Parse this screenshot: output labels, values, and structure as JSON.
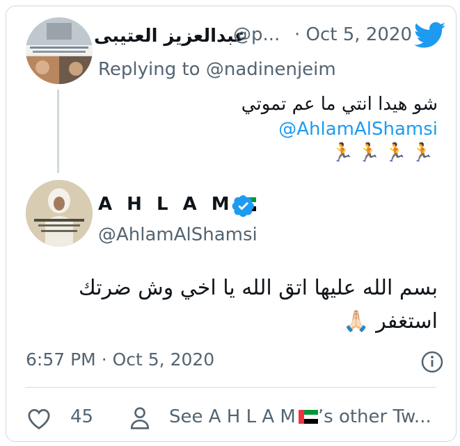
{
  "reply_tweet": {
    "author_name": "عبدالعزيز العتيبى",
    "handle": "@p...",
    "separator": "·",
    "date": "Oct 5, 2020",
    "replying_to_label": "Replying to",
    "replying_to_handle": "@nadinenjeim",
    "text": "شو هيدا انتي ما عم تموتي",
    "mention": "@AhlamAlShamsi",
    "emoji_line": "🏃🏃🏃🏃"
  },
  "main_tweet": {
    "author_name": "A H L A M",
    "handle": "@AhlamAlShamsi",
    "text": "بسم الله عليها اتق الله يا اخي وش ضرتك استغفر 🙏🏻",
    "time": "6:57 PM",
    "separator": "·",
    "date": "Oct 5, 2020"
  },
  "actions": {
    "like_count": "45",
    "see_other_prefix": "See A H L A M",
    "see_other_suffix": "’s other Tw..."
  },
  "colors": {
    "accent": "#1d9bf0",
    "secondary_text": "#536471",
    "primary_text": "#0f1419",
    "border": "#cfd9de"
  }
}
